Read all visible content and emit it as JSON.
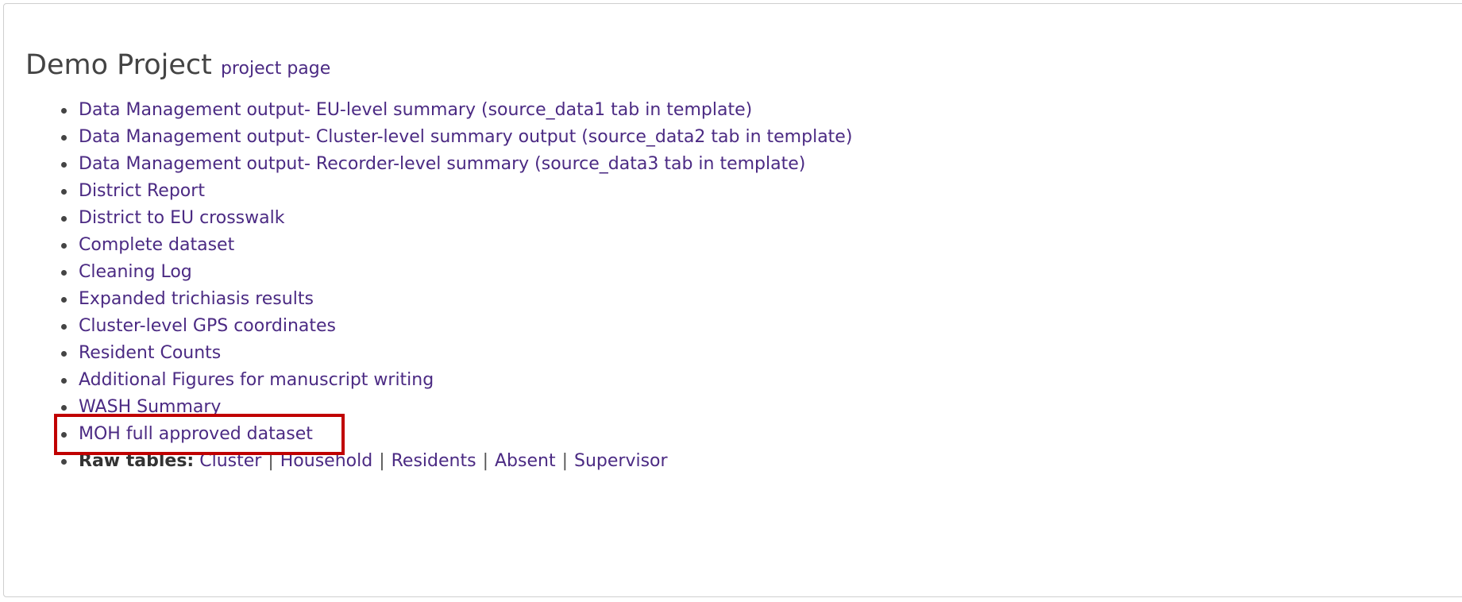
{
  "header": {
    "title": "Demo Project",
    "project_link": "project page"
  },
  "links": [
    "Data Management output- EU-level summary (source_data1 tab in template)",
    "Data Management output- Cluster-level summary output (source_data2 tab in template)",
    "Data Management output- Recorder-level summary (source_data3 tab in template)",
    "District Report",
    "District to EU crosswalk",
    "Complete dataset",
    "Cleaning Log",
    "Expanded trichiasis results",
    "Cluster-level GPS coordinates",
    "Resident Counts",
    "Additional Figures for manuscript writing",
    "WASH Summary",
    "MOH full approved dataset"
  ],
  "raw_tables": {
    "label": "Raw tables:",
    "items": [
      "Cluster",
      "Household",
      "Residents",
      "Absent",
      "Supervisor"
    ],
    "separator": "|"
  },
  "colors": {
    "link": "#4b2a83",
    "highlight": "#c00000"
  }
}
